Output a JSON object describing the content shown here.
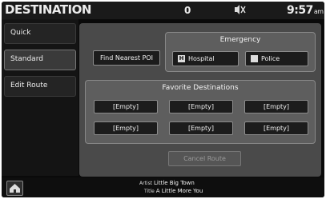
{
  "header": {
    "title": "DESTINATION",
    "number": "0",
    "mute_icon": "mute-icon",
    "clock": "9:57",
    "clock_suffix": "am"
  },
  "sidebar": {
    "items": [
      {
        "label": "Quick"
      },
      {
        "label": "Standard"
      },
      {
        "label": "Edit Route"
      }
    ]
  },
  "main": {
    "find_nearest_label": "Find Nearest POI",
    "emergency": {
      "title": "Emergency",
      "hospital_label": "Hospital",
      "police_label": "Police",
      "hospital_badge": "H"
    },
    "favorites": {
      "title": "Favorite Destinations",
      "slots": [
        "[Empty]",
        "[Empty]",
        "[Empty]",
        "[Empty]",
        "[Empty]",
        "[Empty]"
      ]
    },
    "cancel_route_label": "Cancel Route"
  },
  "now_playing": {
    "artist_prefix": "Artist",
    "artist": "Little Big Town",
    "title_prefix": "Title",
    "title": "A Little More You"
  },
  "colors": {
    "background": "#0a0a0a",
    "panel": "#4a4a4a",
    "button": "#1c1c1c"
  }
}
